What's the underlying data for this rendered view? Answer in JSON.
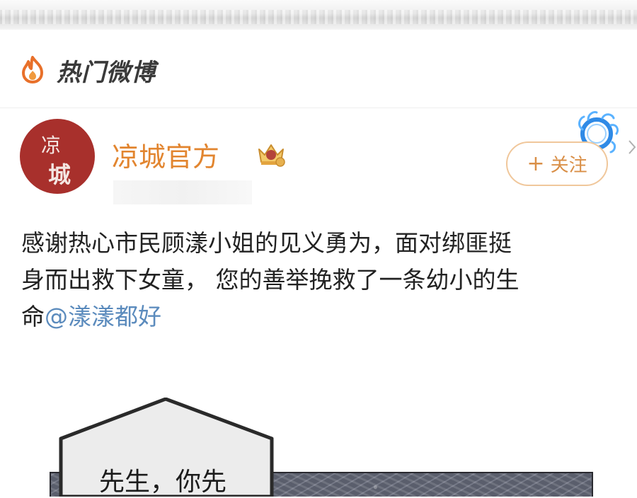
{
  "header": {
    "title": "热门微博"
  },
  "post": {
    "account": {
      "name": "凉城官方",
      "avatar_chars": [
        "凉",
        "城"
      ]
    },
    "follow_button": {
      "label": "关注",
      "plus": "+"
    },
    "text": {
      "line1": "感谢热心市民顾漾小姐的见义勇为，面对绑匪挺",
      "line2": "身而出救下女童， 您的善举挽救了一条幼小的生",
      "line3_prefix": "命",
      "mention": "@漾漾都好"
    }
  },
  "comic": {
    "bubble_text": "先生，你先"
  },
  "colors": {
    "brand_orange": "#e2852f",
    "avatar_red": "#a8302c",
    "mention_blue": "#5b8bbd",
    "follow_border": "#f0c79b"
  },
  "icons": {
    "header_logo": "flame-icon",
    "badge": "crown-badge-icon",
    "follow_deco": "blue-flame-ring-icon",
    "chevron": "chevron-right-icon"
  }
}
